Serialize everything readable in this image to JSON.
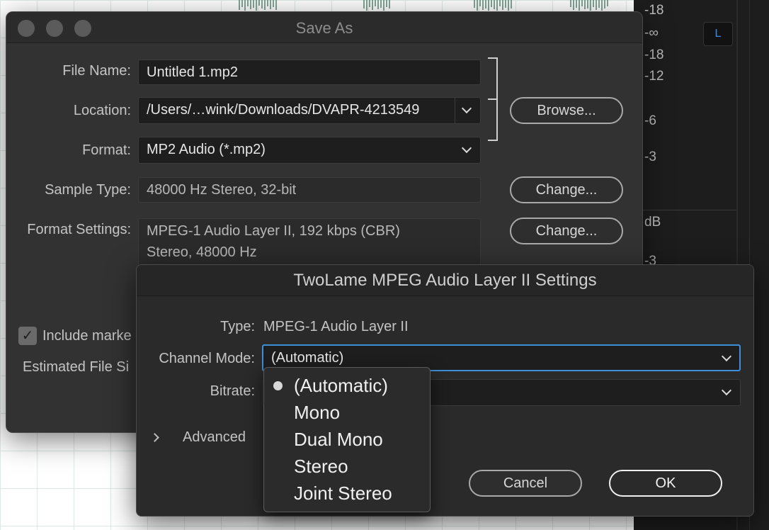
{
  "meter": {
    "labels": [
      "-18",
      "-∞",
      "-18",
      "-12",
      "-6",
      "-3",
      "dB",
      "-3"
    ],
    "channel_badge": "L",
    "badge_color": "#3a8ee6"
  },
  "save_dialog": {
    "title": "Save As",
    "file_name_label": "File Name:",
    "file_name_value": "Untitled 1.mp2",
    "location_label": "Location:",
    "location_value": "/Users/…wink/Downloads/DVAPR-4213549",
    "format_label": "Format:",
    "format_value": "MP2 Audio (*.mp2)",
    "browse_button": "Browse...",
    "sample_type_label": "Sample Type:",
    "sample_type_value": "48000 Hz Stereo, 32-bit",
    "sample_change_button": "Change...",
    "format_settings_label": "Format Settings:",
    "format_settings_line1": "MPEG-1 Audio Layer II, 192 kbps (CBR)",
    "format_settings_line2": "Stereo, 48000 Hz",
    "format_change_button": "Change...",
    "include_markers_label": "Include marke",
    "include_markers_checked": true,
    "estimated_size_label": "Estimated File Si"
  },
  "twolame_dialog": {
    "title": "TwoLame MPEG Audio Layer II Settings",
    "type_label": "Type:",
    "type_value": "MPEG-1 Audio Layer II",
    "channel_mode_label": "Channel Mode:",
    "channel_mode_value": "(Automatic)",
    "bitrate_label": "Bitrate:",
    "bitrate_value": "",
    "advanced_label": "Advanced",
    "cancel_button": "Cancel",
    "ok_button": "OK",
    "focus_color": "#3d8fd8"
  },
  "channel_menu": {
    "selected_index": 0,
    "items": [
      "(Automatic)",
      "Mono",
      "Dual Mono",
      "Stereo",
      "Joint Stereo"
    ]
  }
}
